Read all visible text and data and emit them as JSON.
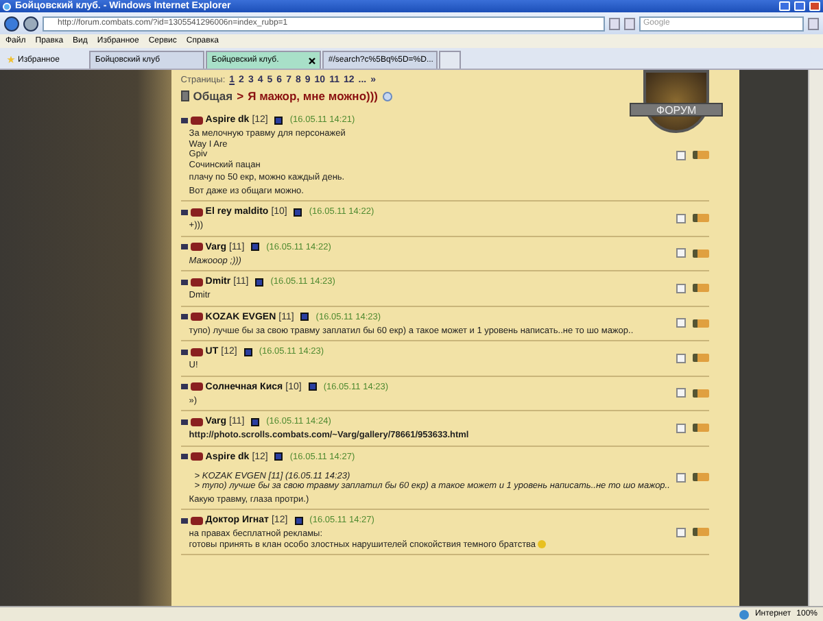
{
  "window": {
    "title": "Бойцовский клуб. - Windows Internet Explorer"
  },
  "address_bar": {
    "url": "http://forum.combats.com/?id=1305541296006n=index_rubp=1"
  },
  "search": {
    "placeholder": "Google"
  },
  "menu": [
    "Файл",
    "Правка",
    "Вид",
    "Избранное",
    "Сервис",
    "Справка"
  ],
  "favorites": {
    "label": "Избранное"
  },
  "tabs": [
    {
      "label": "Бойцовский клуб",
      "selected": false
    },
    {
      "label": "Бойцовский клуб.",
      "selected": true
    },
    {
      "label": "#/search?c%5Bq%5D=%D...",
      "selected": false
    }
  ],
  "forum": {
    "logo_text": "ФОРУМ",
    "pages_label": "Страницы:",
    "pages": [
      {
        "label": "1",
        "selected": true
      },
      {
        "label": "2",
        "selected": false
      },
      {
        "label": "3",
        "selected": false
      },
      {
        "label": "4",
        "selected": false
      },
      {
        "label": "5",
        "selected": false
      },
      {
        "label": "6",
        "selected": false
      },
      {
        "label": "7",
        "selected": false
      },
      {
        "label": "8",
        "selected": false
      },
      {
        "label": "9",
        "selected": false
      },
      {
        "label": "10",
        "selected": false
      },
      {
        "label": "11",
        "selected": false
      },
      {
        "label": "12",
        "selected": false
      },
      {
        "label": "...",
        "selected": false
      },
      {
        "label": "»",
        "selected": false
      }
    ],
    "breadcrumb": {
      "section": "Общая",
      "separator": ">",
      "topic": "Я мажор, мне можно)))"
    },
    "posts": [
      {
        "author": "Aspire dk",
        "level": "[12]",
        "date": "(16.05.11 14:21)",
        "checked": false,
        "paragraphs": [
          {
            "kind": "text",
            "lines": [
              "За мелочную травму для персонажей",
              "Way I Are",
              "Gpiv",
              "Сочинский пацан"
            ]
          },
          {
            "kind": "text",
            "lines": [
              "плачу по 50 екр, можно каждый день."
            ]
          },
          {
            "kind": "text",
            "lines": [
              "Вот даже из общаги можно."
            ]
          }
        ]
      },
      {
        "author": "El rey maldito",
        "level": "[10]",
        "date": "(16.05.11 14:22)",
        "checked": false,
        "paragraphs": [
          {
            "kind": "text",
            "lines": [
              "+)))"
            ]
          }
        ]
      },
      {
        "author": "Varg",
        "level": "[11]",
        "date": "(16.05.11 14:22)",
        "checked": false,
        "paragraphs": [
          {
            "kind": "italic",
            "lines": [
              "Мажооор ;)))"
            ]
          }
        ]
      },
      {
        "author": "Dmitr",
        "level": "[11]",
        "date": "(16.05.11 14:23)",
        "checked": false,
        "paragraphs": [
          {
            "kind": "text",
            "lines": [
              "Dmitr"
            ]
          }
        ]
      },
      {
        "author": "KOZAK EVGEN",
        "level": "[11]",
        "date": "(16.05.11 14:23)",
        "checked": false,
        "paragraphs": [
          {
            "kind": "text",
            "lines": [
              "тупо) лучше бы за свою травму заплатил бы 60 екр) а такое может и 1 уровень написать..не то шо мажор.."
            ]
          }
        ]
      },
      {
        "author": "UT",
        "level": "[12]",
        "date": "(16.05.11 14:23)",
        "checked": false,
        "paragraphs": [
          {
            "kind": "text",
            "lines": [
              "U!"
            ]
          }
        ]
      },
      {
        "author": "Солнечная Кися",
        "level": "[10]",
        "date": "(16.05.11 14:23)",
        "checked": false,
        "paragraphs": [
          {
            "kind": "text",
            "lines": [
              "»)"
            ]
          }
        ]
      },
      {
        "author": "Varg",
        "level": "[11]",
        "date": "(16.05.11 14:24)",
        "checked": false,
        "paragraphs": [
          {
            "kind": "link",
            "lines": [
              "http://photo.scrolls.combats.com/~Varg/gallery/78661/953633.html"
            ]
          }
        ]
      },
      {
        "author": "Aspire dk",
        "level": "[12]",
        "date": "(16.05.11 14:27)",
        "checked": false,
        "paragraphs": [
          {
            "kind": "quote",
            "lines": [
              ">  KOZAK EVGEN [11] (16.05.11 14:23)",
              "> тупо) лучше бы за свою травму заплатил бы 60 екр) а такое может и 1 уровень написать..не то шо мажор.."
            ]
          },
          {
            "kind": "text",
            "lines": [
              "Какую травму, глаза протри.)"
            ]
          }
        ]
      },
      {
        "author": "Доктор Игнат",
        "level": "[12]",
        "date": "(16.05.11 14:27)",
        "checked": false,
        "paragraphs": [
          {
            "kind": "text",
            "lines": [
              "на правах бесплатной рекламы:",
              "готовы принять в клан особо злостных нарушителей спокойствия темного братства"
            ]
          }
        ]
      }
    ]
  },
  "status_bar": {
    "zone": "Интернет",
    "zoom": "100%"
  }
}
